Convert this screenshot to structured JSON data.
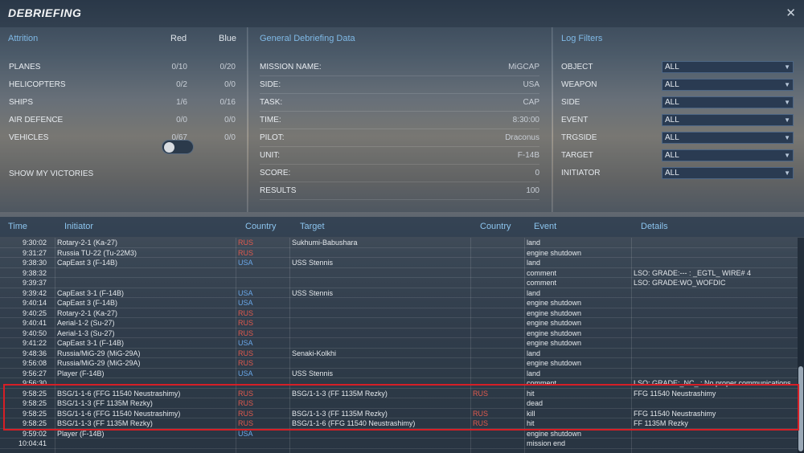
{
  "window": {
    "title": "DEBRIEFING",
    "close_glyph": "✕"
  },
  "attrition": {
    "title": "Attrition",
    "red_label": "Red",
    "blue_label": "Blue",
    "rows": [
      {
        "label": "PLANES",
        "red": "0/10",
        "blue": "0/20"
      },
      {
        "label": "HELICOPTERS",
        "red": "0/2",
        "blue": "0/0"
      },
      {
        "label": "SHIPS",
        "red": "1/6",
        "blue": "0/16"
      },
      {
        "label": "AIR DEFENCE",
        "red": "0/0",
        "blue": "0/0"
      },
      {
        "label": "VEHICLES",
        "red": "0/67",
        "blue": "0/0"
      }
    ],
    "show_victories_label": "SHOW MY VICTORIES",
    "show_victories_on": false
  },
  "general": {
    "title": "General Debriefing Data",
    "rows": [
      {
        "label": "MISSION NAME:",
        "value": "MiGCAP"
      },
      {
        "label": "SIDE:",
        "value": "USA"
      },
      {
        "label": "TASK:",
        "value": "CAP"
      },
      {
        "label": "TIME:",
        "value": "8:30:00"
      },
      {
        "label": "PILOT:",
        "value": "Draconus"
      },
      {
        "label": "UNIT:",
        "value": "F-14B"
      },
      {
        "label": "SCORE:",
        "value": "0"
      },
      {
        "label": "RESULTS",
        "value": "100"
      }
    ]
  },
  "filters": {
    "title": "Log Filters",
    "rows": [
      {
        "label": "OBJECT",
        "value": "ALL"
      },
      {
        "label": "WEAPON",
        "value": "ALL"
      },
      {
        "label": "SIDE",
        "value": "ALL"
      },
      {
        "label": "EVENT",
        "value": "ALL"
      },
      {
        "label": "TRGSIDE",
        "value": "ALL"
      },
      {
        "label": "TARGET",
        "value": "ALL"
      },
      {
        "label": "INITIATOR",
        "value": "ALL"
      }
    ]
  },
  "log": {
    "headers": {
      "time": "Time",
      "initiator": "Initiator",
      "country": "Country",
      "target": "Target",
      "target_country": "Country",
      "event": "Event",
      "details": "Details"
    },
    "rows": [
      {
        "time": "9:30:02",
        "initiator": "Rotary-2-1 (Ka-27)",
        "ic": "RUS",
        "target": "Sukhumi-Babushara",
        "tc": "",
        "event": "land",
        "details": ""
      },
      {
        "time": "9:31:27",
        "initiator": "Russia TU-22 (Tu-22M3)",
        "ic": "RUS",
        "target": "",
        "tc": "",
        "event": "engine shutdown",
        "details": ""
      },
      {
        "time": "9:38:30",
        "initiator": "CapEast 3 (F-14B)",
        "ic": "USA",
        "target": "USS Stennis",
        "tc": "",
        "event": "land",
        "details": ""
      },
      {
        "time": "9:38:32",
        "initiator": "",
        "ic": "",
        "target": "",
        "tc": "",
        "event": "comment",
        "details": "LSO: GRADE:--- : _EGTL_ WIRE# 4"
      },
      {
        "time": "9:39:37",
        "initiator": "",
        "ic": "",
        "target": "",
        "tc": "",
        "event": "comment",
        "details": "LSO: GRADE:WO_WOFDIC"
      },
      {
        "time": "9:39:42",
        "initiator": "CapEast 3-1 (F-14B)",
        "ic": "USA",
        "target": "USS Stennis",
        "tc": "",
        "event": "land",
        "details": ""
      },
      {
        "time": "9:40:14",
        "initiator": "CapEast 3 (F-14B)",
        "ic": "USA",
        "target": "",
        "tc": "",
        "event": "engine shutdown",
        "details": ""
      },
      {
        "time": "9:40:25",
        "initiator": "Rotary-2-1 (Ka-27)",
        "ic": "RUS",
        "target": "",
        "tc": "",
        "event": "engine shutdown",
        "details": ""
      },
      {
        "time": "9:40:41",
        "initiator": "Aerial-1-2 (Su-27)",
        "ic": "RUS",
        "target": "",
        "tc": "",
        "event": "engine shutdown",
        "details": ""
      },
      {
        "time": "9:40:50",
        "initiator": "Aerial-1-3 (Su-27)",
        "ic": "RUS",
        "target": "",
        "tc": "",
        "event": "engine shutdown",
        "details": ""
      },
      {
        "time": "9:41:22",
        "initiator": "CapEast 3-1 (F-14B)",
        "ic": "USA",
        "target": "",
        "tc": "",
        "event": "engine shutdown",
        "details": ""
      },
      {
        "time": "9:48:36",
        "initiator": "Russia/MiG-29 (MiG-29A)",
        "ic": "RUS",
        "target": "Senaki-Kolkhi",
        "tc": "",
        "event": "land",
        "details": ""
      },
      {
        "time": "9:56:08",
        "initiator": "Russia/MiG-29 (MiG-29A)",
        "ic": "RUS",
        "target": "",
        "tc": "",
        "event": "engine shutdown",
        "details": ""
      },
      {
        "time": "9:56:27",
        "initiator": "Player (F-14B)",
        "ic": "USA",
        "target": "USS Stennis",
        "tc": "",
        "event": "land",
        "details": ""
      },
      {
        "time": "9:56:30",
        "initiator": "",
        "ic": "",
        "target": "",
        "tc": "",
        "event": "comment",
        "details": "LSO: GRADE:_NC_ : No proper communications"
      },
      {
        "time": "9:58:25",
        "initiator": "BSG/1-1-6 (FFG 11540 Neustrashimy)",
        "ic": "RUS",
        "target": "BSG/1-1-3 (FF 1135M Rezky)",
        "tc": "RUS",
        "event": "hit",
        "details": "FFG 11540 Neustrashimy"
      },
      {
        "time": "9:58:25",
        "initiator": "BSG/1-1-3 (FF 1135M Rezky)",
        "ic": "RUS",
        "target": "",
        "tc": "",
        "event": "dead",
        "details": ""
      },
      {
        "time": "9:58:25",
        "initiator": "BSG/1-1-6 (FFG 11540 Neustrashimy)",
        "ic": "RUS",
        "target": "BSG/1-1-3 (FF 1135M Rezky)",
        "tc": "RUS",
        "event": "kill",
        "details": "FFG 11540 Neustrashimy"
      },
      {
        "time": "9:58:25",
        "initiator": "BSG/1-1-3 (FF 1135M Rezky)",
        "ic": "RUS",
        "target": "BSG/1-1-6 (FFG 11540 Neustrashimy)",
        "tc": "RUS",
        "event": "hit",
        "details": "FF 1135M Rezky"
      },
      {
        "time": "9:59:02",
        "initiator": "Player (F-14B)",
        "ic": "USA",
        "target": "",
        "tc": "",
        "event": "engine shutdown",
        "details": ""
      },
      {
        "time": "10:04:41",
        "initiator": "",
        "ic": "",
        "target": "",
        "tc": "",
        "event": "mission end",
        "details": ""
      }
    ]
  }
}
